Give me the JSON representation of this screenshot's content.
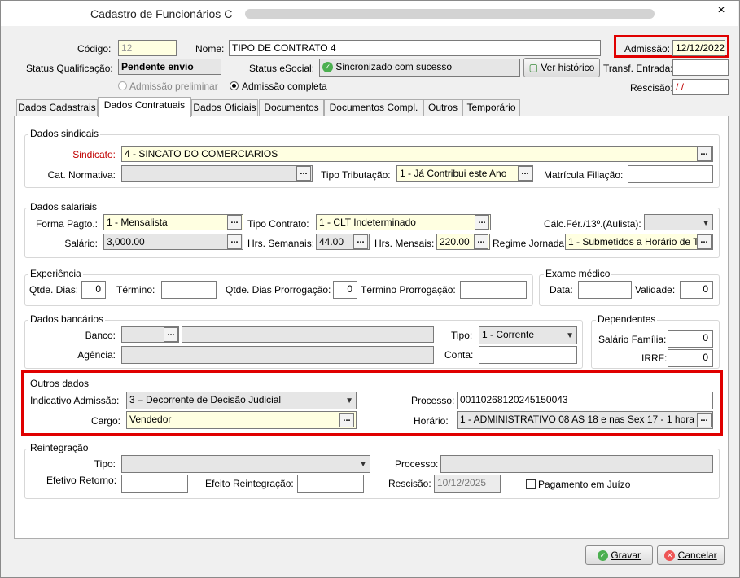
{
  "window": {
    "title": "Cadastro de Funcionários",
    "title_suffix": "C",
    "close_icon": "×"
  },
  "header": {
    "codigo_label": "Código:",
    "codigo_value": "12",
    "nome_label": "Nome:",
    "nome_value": "TIPO DE CONTRATO 4",
    "admissao_label": "Admissão:",
    "admissao_value": "12/12/2022",
    "status_qual_label": "Status Qualificação:",
    "status_qual_value": "Pendente envio",
    "status_esocial_label": "Status eSocial:",
    "status_esocial_value": "Sincronizado com sucesso",
    "ver_historico": "Ver histórico",
    "transf_label": "Transf. Entrada:",
    "transf_value": "",
    "rescisao_label": "Rescisão:",
    "rescisao_value": " /  /",
    "radio_preliminar": "Admissão preliminar",
    "radio_completa": "Admissão completa"
  },
  "tabs": [
    "Dados Cadastrais",
    "Dados Contratuais",
    "Dados Oficiais",
    "Documentos",
    "Documentos Compl.",
    "Outros",
    "Temporário"
  ],
  "sindicais": {
    "title": "Dados sindicais",
    "sindicato_label": "Sindicato:",
    "sindicato_value": "4 - SINCATO DO COMERCIARIOS",
    "cat_label": "Cat. Normativa:",
    "cat_value": "",
    "tipo_trib_label": "Tipo Tributação:",
    "tipo_trib_value": "1 - Já Contribui este Ano",
    "matricula_label": "Matrícula Filiação:",
    "matricula_value": ""
  },
  "salariais": {
    "title": "Dados salariais",
    "forma_label": "Forma Pagto.:",
    "forma_value": "1 -  Mensalista",
    "tipo_contrato_label": "Tipo Contrato:",
    "tipo_contrato_value": "1 - CLT Indeterminado",
    "calc_label": "Cálc.Fér./13º.(Aulista):",
    "calc_value": "",
    "salario_label": "Salário:",
    "salario_value": "3,000.00",
    "hrs_sem_label": "Hrs. Semanais:",
    "hrs_sem_value": "44.00",
    "hrs_mes_label": "Hrs. Mensais:",
    "hrs_mes_value": "220.00",
    "regime_label": "Regime Jornada:",
    "regime_value": "1 - Submetidos a Horário de T"
  },
  "experiencia": {
    "title": "Experiência",
    "qtde_label": "Qtde. Dias:",
    "qtde_value": "0",
    "termino_label": "Término:",
    "termino_value": "",
    "prorrog_label": "Qtde. Dias Prorrogação:",
    "prorrog_value": "0",
    "termino_prorrog_label": "Término Prorrogação:",
    "termino_prorrog_value": ""
  },
  "exame": {
    "title": "Exame médico",
    "data_label": "Data:",
    "data_value": "",
    "validade_label": "Validade:",
    "validade_value": "0"
  },
  "bancarios": {
    "title": "Dados bancários",
    "banco_label": "Banco:",
    "banco_value": "",
    "banco_nome": "",
    "agencia_label": "Agência:",
    "agencia_value": "",
    "tipo_label": "Tipo:",
    "tipo_value": "1 - Corrente",
    "conta_label": "Conta:",
    "conta_value": ""
  },
  "dependentes": {
    "title": "Dependentes",
    "sal_fam_label": "Salário Família:",
    "sal_fam_value": "0",
    "irrf_label": "IRRF:",
    "irrf_value": "0"
  },
  "outros": {
    "title": "Outros dados",
    "indicativo_label": "Indicativo Admissão:",
    "indicativo_value": "3 – Decorrente de Decisão Judicial",
    "processo_label": "Processo:",
    "processo_value": "00110268120245150043",
    "cargo_label": "Cargo:",
    "cargo_value": "Vendedor",
    "horario_label": "Horário:",
    "horario_value": "1 - ADMINISTRATIVO 08 AS 18 e nas Sex 17 - 1 hora"
  },
  "reintegracao": {
    "title": "Reintegração",
    "tipo_label": "Tipo:",
    "tipo_value": "",
    "processo_label": "Processo:",
    "processo_value": "",
    "efetivo_label": "Efetivo Retorno:",
    "efetivo_value": "",
    "efeito_label": "Efeito Reintegração:",
    "efeito_value": "",
    "rescisao_label": "Rescisão:",
    "rescisao_value": "10/12/2025",
    "pagamento_label": "Pagamento em Juízo"
  },
  "footer": {
    "gravar": "Gravar",
    "cancelar": "Cancelar"
  },
  "colors": {
    "highlight": "#e00000",
    "required_label": "#c00000",
    "input_yellow": "#ffffe1"
  }
}
